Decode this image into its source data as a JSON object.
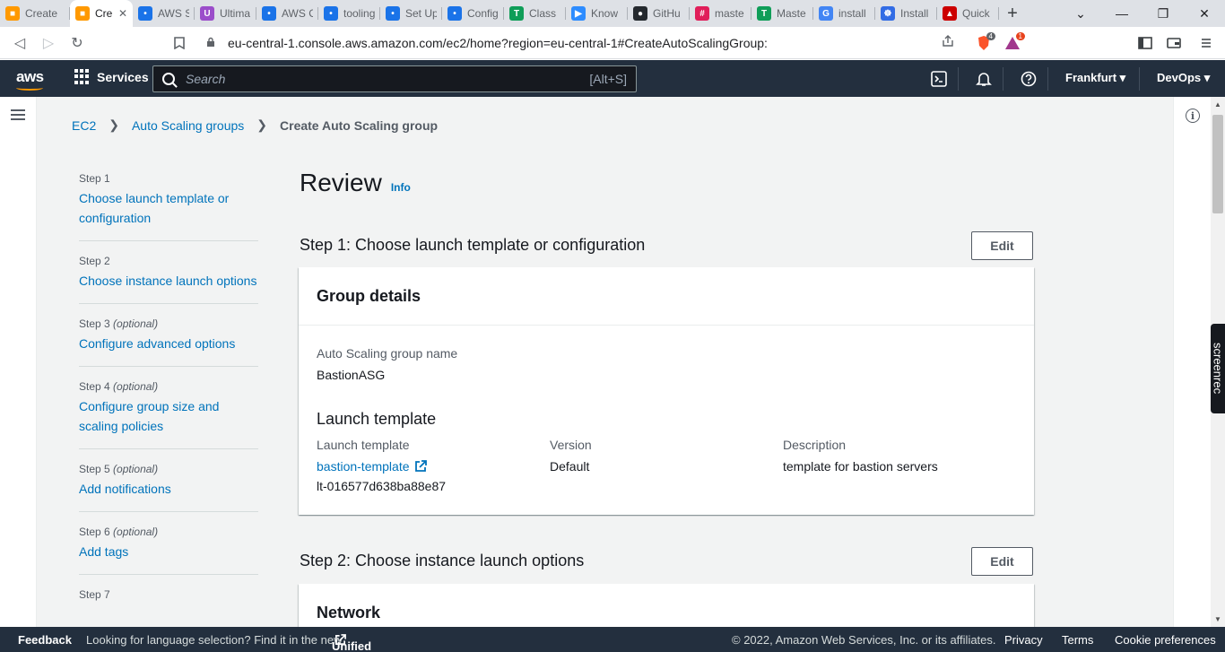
{
  "browser": {
    "tabs": [
      {
        "label": "Create",
        "color": "#ff9900",
        "glyph": "■"
      },
      {
        "label": "Cre",
        "color": "#ff9900",
        "glyph": "■",
        "active": true
      },
      {
        "label": "AWS S",
        "color": "#1a73e8",
        "glyph": "•"
      },
      {
        "label": "Ultima",
        "color": "#9b4dca",
        "glyph": "U"
      },
      {
        "label": "AWS C",
        "color": "#1a73e8",
        "glyph": "•"
      },
      {
        "label": "tooling",
        "color": "#1a73e8",
        "glyph": "•"
      },
      {
        "label": "Set Up",
        "color": "#1a73e8",
        "glyph": "•"
      },
      {
        "label": "Config",
        "color": "#1a73e8",
        "glyph": "•"
      },
      {
        "label": "Class",
        "color": "#0f9d58",
        "glyph": "T"
      },
      {
        "label": "Know",
        "color": "#2d8cff",
        "glyph": "▶"
      },
      {
        "label": "GitHu",
        "color": "#24292e",
        "glyph": "●"
      },
      {
        "label": "maste",
        "color": "#e01e5a",
        "glyph": "#"
      },
      {
        "label": "Maste",
        "color": "#0f9d58",
        "glyph": "T"
      },
      {
        "label": "install",
        "color": "#4285f4",
        "glyph": "G"
      },
      {
        "label": "Install",
        "color": "#326ce5",
        "glyph": "☸"
      },
      {
        "label": "Quick",
        "color": "#cc0000",
        "glyph": "▲"
      }
    ],
    "url": "eu-central-1.console.aws.amazon.com/ec2/home?region=eu-central-1#CreateAutoScalingGroup:",
    "brave_badge": "4",
    "rewards_badge": "1"
  },
  "nav": {
    "logo": "aws",
    "services_label": "Services",
    "search_placeholder": "Search",
    "search_shortcut": "[Alt+S]",
    "region": "Frankfurt ▾",
    "account": "DevOps ▾"
  },
  "breadcrumb": {
    "items": [
      "EC2",
      "Auto Scaling groups"
    ],
    "current": "Create Auto Scaling group"
  },
  "steps": [
    {
      "num": "Step 1",
      "optional": "",
      "label": "Choose launch template or configuration"
    },
    {
      "num": "Step 2",
      "optional": "",
      "label": "Choose instance launch options"
    },
    {
      "num": "Step 3",
      "optional": "(optional)",
      "label": "Configure advanced options"
    },
    {
      "num": "Step 4",
      "optional": "(optional)",
      "label": "Configure group size and scaling policies"
    },
    {
      "num": "Step 5",
      "optional": "(optional)",
      "label": "Add notifications"
    },
    {
      "num": "Step 6",
      "optional": "(optional)",
      "label": "Add tags"
    },
    {
      "num": "Step 7",
      "optional": "",
      "label": ""
    }
  ],
  "review": {
    "title": "Review",
    "info": "Info",
    "step1_header": "Step 1: Choose launch template or configuration",
    "edit_label": "Edit",
    "group_details": {
      "header": "Group details",
      "asg_name_label": "Auto Scaling group name",
      "asg_name_value": "BastionASG",
      "launch_template_header": "Launch template",
      "lt_label": "Launch template",
      "lt_value": "bastion-template",
      "lt_id": "lt-016577d638ba88e87",
      "version_label": "Version",
      "version_value": "Default",
      "description_label": "Description",
      "description_value": "template for bastion servers"
    },
    "step2_header": "Step 2: Choose instance launch options",
    "network_header": "Network"
  },
  "footer": {
    "feedback": "Feedback",
    "language_text": "Looking for language selection? Find it in the new",
    "unified_settings": "Unified Settings",
    "copyright": "© 2022, Amazon Web Services, Inc. or its affiliates.",
    "privacy": "Privacy",
    "terms": "Terms",
    "cookies": "Cookie preferences"
  },
  "screenrec_label": "screenrec"
}
